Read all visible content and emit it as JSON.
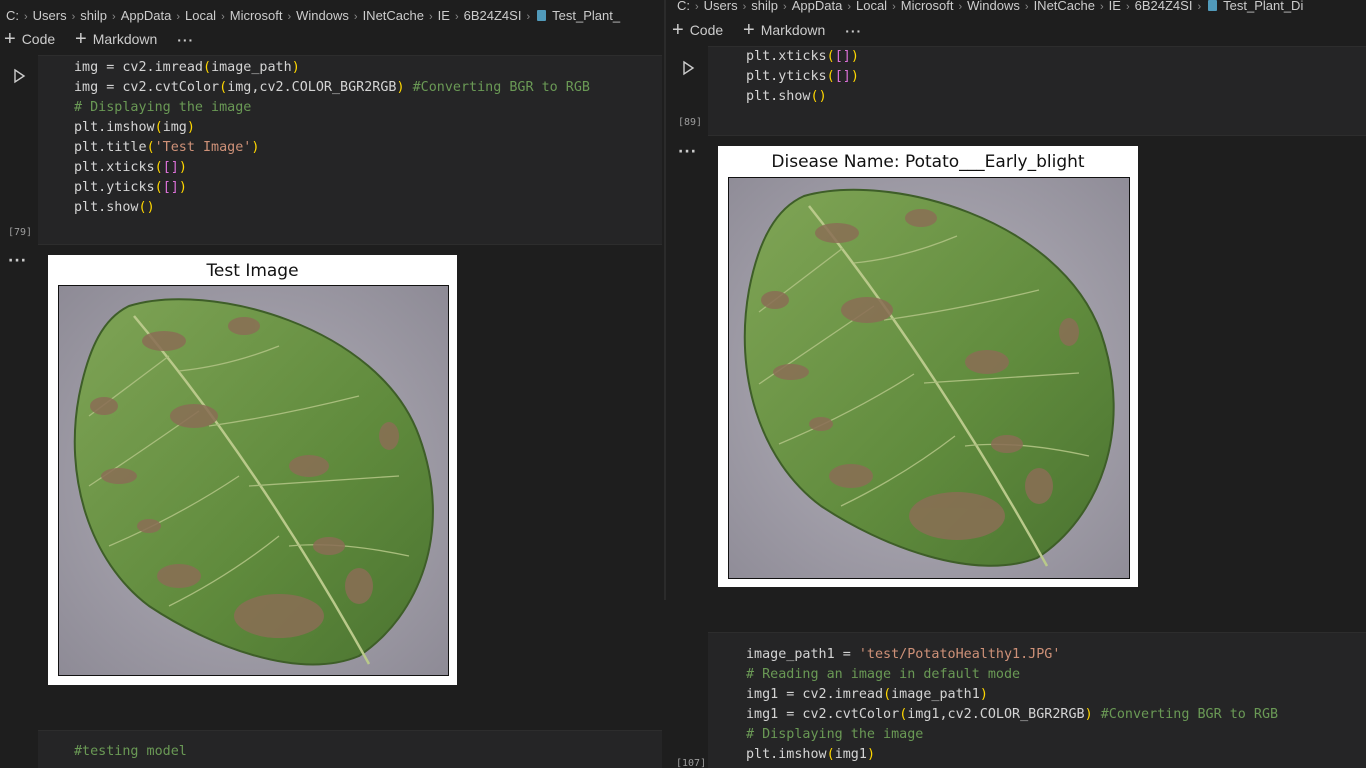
{
  "colors": {
    "background": "#1e1e1e",
    "cell_background": "#252526",
    "string": "#ce9178",
    "comment": "#6a9955",
    "paren_level1": "#ffd700",
    "paren_level2": "#da70d6"
  },
  "left": {
    "breadcrumb": [
      "C:",
      "Users",
      "shilp",
      "AppData",
      "Local",
      "Microsoft",
      "Windows",
      "INetCache",
      "IE",
      "6B24Z4SI",
      "Test_Plant_"
    ],
    "toolbar": {
      "code_label": "Code",
      "markdown_label": "Markdown",
      "more_label": "···"
    },
    "cell1": {
      "exec_count": "[79]",
      "lines": [
        "img = cv2.imread(image_path)",
        "img = cv2.cvtColor(img,cv2.COLOR_BGR2RGB) #Converting BGR to RGB",
        "# Displaying the image",
        "plt.imshow(img)",
        "plt.title('Test Image')",
        "plt.xticks([])",
        "plt.yticks([])",
        "plt.show()"
      ]
    },
    "output1": {
      "more_label": "···",
      "figure_title": "Test Image"
    },
    "cell2": {
      "lines": [
        "#testing model"
      ]
    }
  },
  "right": {
    "breadcrumb": [
      "C:",
      "Users",
      "shilp",
      "AppData",
      "Local",
      "Microsoft",
      "Windows",
      "INetCache",
      "IE",
      "6B24Z4SI",
      "Test_Plant_Di"
    ],
    "toolbar": {
      "code_label": "Code",
      "markdown_label": "Markdown",
      "more_label": "···"
    },
    "cell1": {
      "exec_count": "[89]",
      "lines": [
        "plt.xticks([])",
        "plt.yticks([])",
        "plt.show()"
      ]
    },
    "output1": {
      "more_label": "···",
      "figure_title": "Disease Name: Potato___Early_blight"
    },
    "cell2": {
      "exec_count": "[107]",
      "lines": [
        "image_path1 = 'test/PotatoHealthy1.JPG'",
        "# Reading an image in default mode",
        "img1 = cv2.imread(image_path1)",
        "img1 = cv2.cvtColor(img1,cv2.COLOR_BGR2RGB) #Converting BGR to RGB",
        "# Displaying the image",
        "plt.imshow(img1)"
      ]
    }
  }
}
